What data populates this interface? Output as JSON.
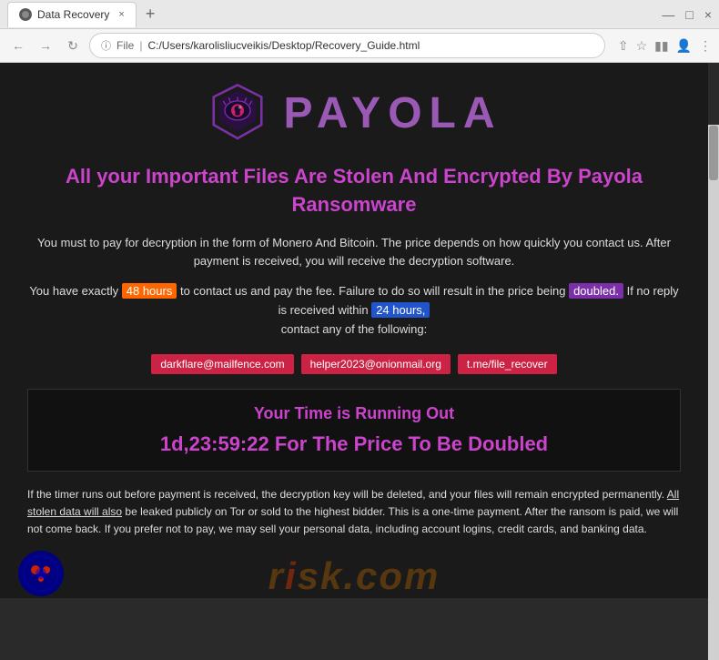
{
  "browser": {
    "tab_title": "Data Recovery",
    "tab_close": "×",
    "new_tab": "+",
    "window_minimize": "—",
    "window_maximize": "□",
    "window_close": "×",
    "nav_back": "←",
    "nav_forward": "→",
    "nav_reload": "↻",
    "address_protocol": "File",
    "address_url": "C:/Users/karolisliucveikis/Desktop/Recovery_Guide.html"
  },
  "page": {
    "logo_text": "PAYOLA",
    "main_heading": "All your Important Files Are Stolen And Encrypted By Payola Ransomware",
    "body_text_1": "You must to pay for decryption in the form of Monero And Bitcoin. The price depends on how quickly you contact us. After payment is received, you will receive the decryption software.",
    "body_text_2_pre": "You have exactly",
    "highlight_48h": "48 hours",
    "body_text_2_mid": "to contact us and pay the fee. Failure to do so will result in the price being",
    "highlight_doubled": "doubled.",
    "body_text_2_post": "If no reply is received within",
    "highlight_24h": "24 hours,",
    "body_text_2_end": "contact any of the following:",
    "contact_1": "darkflare@mailfence.com",
    "contact_2": "helper2023@onionmail.org",
    "contact_3": "t.me/file_recover",
    "timer_heading": "Your Time is Running Out",
    "timer_value": "1d,23:59:22 For The Price To Be Doubled",
    "footer_text": "If the timer runs out before payment is received, the decryption key will be deleted, and your files will remain encrypted permanently. All stolen data will also be leaked publicly on Tor or sold to the highest bidder. This is a one-time payment. After the ransom is paid, we will not come back. If you prefer not to pay, we may sell your personal data, including account logins, credit cards, and banking data.",
    "footer_underline": "All stolen data will also",
    "watermark_text": "risk.com"
  }
}
